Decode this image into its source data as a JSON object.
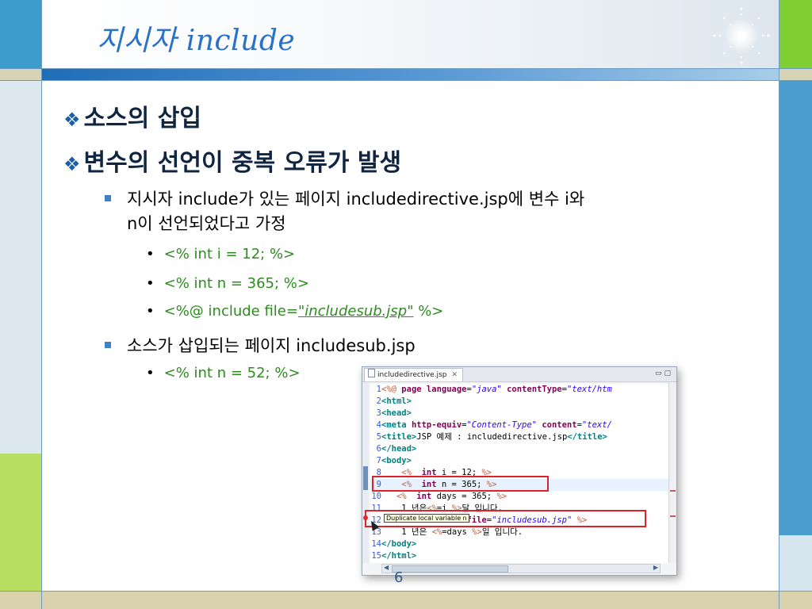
{
  "slide": {
    "title": "지시자 include",
    "page_number": "6"
  },
  "bullets": {
    "l1_a": "소스의 삽입",
    "l1_b": "변수의 선언이 중복 오류가 발생",
    "l2_a_line1": "지시자 include가 있는 페이지 includedirective.jsp에 변수 i와",
    "l2_a_line2": "n이 선언되었다고 가정",
    "l3_a": "<% int i = 12; %>",
    "l3_b": "<% int n = 365; %>",
    "l3_c_prefix": "<%@ include file=",
    "l3_c_link": "\"includesub.jsp\"",
    "l3_c_suffix": " %>",
    "l2_b": "소스가 삽입되는 페이지 includesub.jsp",
    "l3_d": "<% int n = 52; %>"
  },
  "editor": {
    "tab_label": "includedirective.jsp",
    "tooltip": "Duplicate local variable n"
  }
}
